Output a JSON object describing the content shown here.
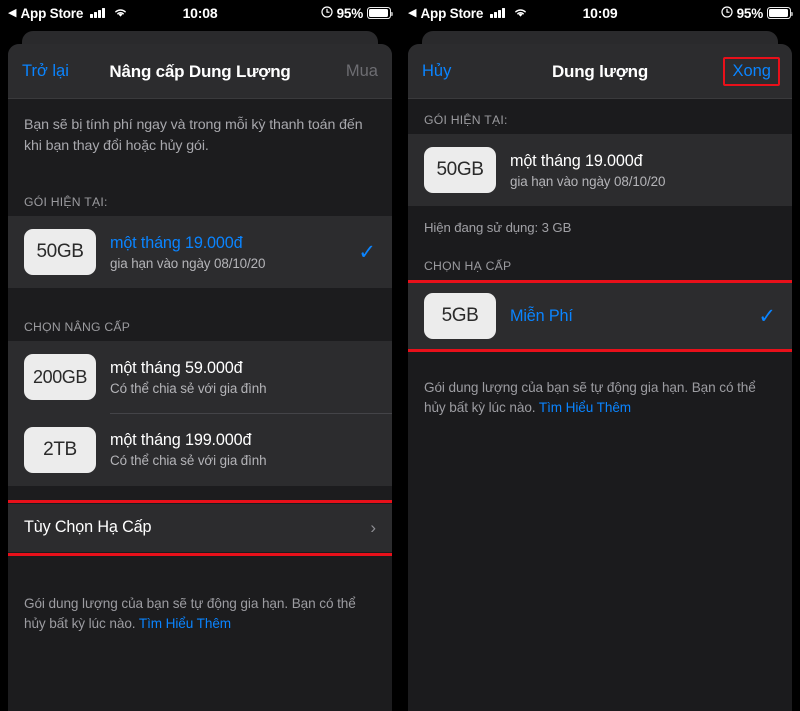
{
  "screens": [
    {
      "id": "left",
      "status_bar": {
        "back_arrow": "◀",
        "app_name": "App Store",
        "signal_icon": "cellular-bars-icon",
        "wifi_icon": "wifi-icon",
        "time": "10:08",
        "lock_icon": "orientation-lock-icon",
        "battery_percent": "95%",
        "battery_icon": "battery-icon"
      },
      "navbar": {
        "left_label": "Trở lại",
        "title": "Nâng cấp Dung Lượng",
        "right_label": "Mua",
        "right_dimmed": true,
        "right_highlighted": false
      },
      "intro": "Bạn sẽ bị tính phí ngay và trong mỗi kỳ thanh toán đến khi bạn thay đổi hoặc hủy gói.",
      "current_plan_label": "GÓI HIỆN TẠI:",
      "current_plan": {
        "size": "50GB",
        "title": "một tháng 19.000đ",
        "title_accent": true,
        "subtitle": "gia hạn vào ngày 08/10/20",
        "selected": true,
        "check_icon": "checkmark-icon"
      },
      "upgrade_label": "CHỌN NÂNG CẤP",
      "upgrade_options": [
        {
          "size": "200GB",
          "title": "một tháng 59.000đ",
          "subtitle": "Có thể chia sẻ với gia đình"
        },
        {
          "size": "2TB",
          "title": "một tháng 199.000đ",
          "subtitle": "Có thể chia sẻ với gia đình"
        }
      ],
      "downgrade_link": {
        "label": "Tùy Chọn Hạ Cấp",
        "chevron_icon": "chevron-right-icon",
        "highlighted": true
      },
      "footer": {
        "text": "Gói dung lượng của bạn sẽ tự động gia hạn. Bạn có thể hủy bất kỳ lúc nào.",
        "link": "Tìm Hiểu Thêm"
      }
    },
    {
      "id": "right",
      "status_bar": {
        "back_arrow": "◀",
        "app_name": "App Store",
        "signal_icon": "cellular-bars-icon",
        "wifi_icon": "wifi-icon",
        "time": "10:09",
        "lock_icon": "orientation-lock-icon",
        "battery_percent": "95%",
        "battery_icon": "battery-icon"
      },
      "navbar": {
        "left_label": "Hủy",
        "title": "Dung lượng",
        "right_label": "Xong",
        "right_dimmed": false,
        "right_highlighted": true
      },
      "current_plan_label": "GÓI HIỆN TẠI:",
      "current_plan": {
        "size": "50GB",
        "title": "một tháng 19.000đ",
        "title_accent": false,
        "subtitle": "gia hạn vào ngày 08/10/20",
        "selected": false
      },
      "usage_note": "Hiện đang sử dụng: 3 GB",
      "downgrade_label": "CHỌN HẠ CẤP",
      "downgrade_option": {
        "size": "5GB",
        "title": "Miễn Phí",
        "title_accent": true,
        "selected": true,
        "check_icon": "checkmark-icon",
        "highlighted": true
      },
      "footer": {
        "text": "Gói dung lượng của bạn sẽ tự động gia hạn. Bạn có thể hủy bất kỳ lúc nào.",
        "link": "Tìm Hiểu Thêm"
      }
    }
  ],
  "colors": {
    "accent_blue": "#0a84ff",
    "annotation_red": "#e8101a",
    "card_bg": "#2c2c2e",
    "sheet_bg": "#1c1c1e",
    "chip_bg": "#ececec"
  }
}
